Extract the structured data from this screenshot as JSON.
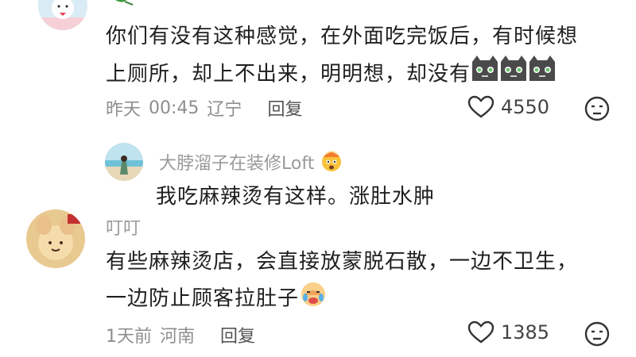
{
  "comments": [
    {
      "text_line1": "你们有没有这种感觉，在外面吃完饭后，有时候想",
      "text_line2": "上厕所，却上不出来，明明想，却没有",
      "date": "昨天",
      "time": "00:45",
      "location": "辽宁",
      "reply_label": "回复",
      "likes": "4550",
      "trailing_emoji": "cat-face-emoji"
    },
    {
      "username": "大脖溜子在装修Loft",
      "text": "我吃麻辣烫有这样。涨肚水肿",
      "name_emoji": "exploding-head-emoji"
    },
    {
      "username": "叮叮",
      "text_line1": "有些麻辣烫店，会直接放蒙脱石散，一边不卫生，",
      "text_line2": "一边防止顾客拉肚子",
      "date": "1天前",
      "location": "河南",
      "reply_label": "回复",
      "likes": "1385",
      "trailing_emoji": "crying-face-emoji"
    }
  ]
}
